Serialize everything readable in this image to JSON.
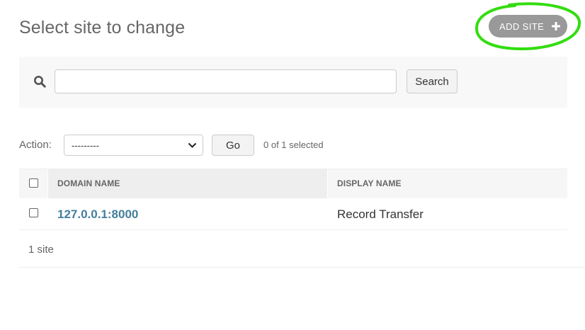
{
  "header": {
    "title": "Select site to change",
    "add_button_label": "ADD SITE",
    "add_button_color": "#999999",
    "annotation_color": "#33dd11"
  },
  "search": {
    "value": "",
    "placeholder": "",
    "button_label": "Search"
  },
  "actions": {
    "label": "Action:",
    "selected_option": "---------",
    "go_label": "Go",
    "selection_counter": "0 of 1 selected"
  },
  "table": {
    "columns": [
      "DOMAIN NAME",
      "DISPLAY NAME"
    ],
    "sorted_column": "DOMAIN NAME",
    "rows": [
      {
        "domain": "127.0.0.1:8000",
        "display": "Record Transfer"
      }
    ],
    "link_color": "#447e9b"
  },
  "paginator": {
    "text": "1 site"
  }
}
